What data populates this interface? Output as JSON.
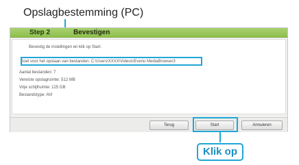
{
  "callout": {
    "destination_label": "Opslagbestemming (PC)",
    "click_label": "Klik op"
  },
  "window": {
    "step": "Step 2",
    "title": "Bevestigen",
    "intro": "Bevestig de instellingen en klik op Start.",
    "rows": {
      "destination": "Doel voor het opslaan van bestanden: C:\\Users\\XXXX\\Videos\\Everio MediaBrowser3",
      "file_count": "Aantal bestanden: 7",
      "required_space": "Vereiste opslagruimte: 512 MB",
      "free_space": "Vrije schijfruimte: 125 GB",
      "file_type": "Bestandstype: AVI"
    }
  },
  "buttons": {
    "back": "Terug",
    "start": "Start",
    "cancel": "Annuleren"
  },
  "colors": {
    "accent": "#1ea6d6",
    "header_green": "#8fbf4d"
  }
}
